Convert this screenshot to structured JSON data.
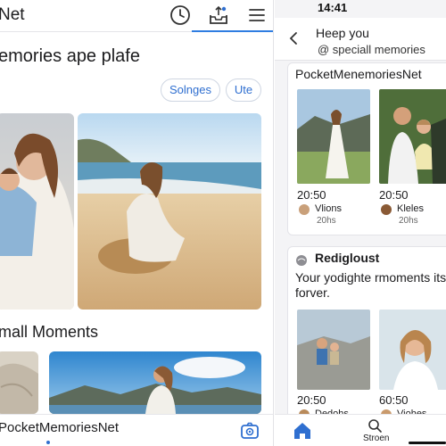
{
  "left": {
    "brand": "Net",
    "header_icons": [
      "clock-icon",
      "inbox-upload-icon",
      "menu-icon"
    ],
    "title": "emories ape plafe",
    "pills": [
      "Solnges",
      "Ute"
    ],
    "section_title": "mall Moments",
    "bottom_brand": "PocketMemoriesNet",
    "bottom_icon": "camera-refresh-icon"
  },
  "right": {
    "status_time": "14:41",
    "header_line1": "Heep you",
    "header_line2": "@  speciall memories",
    "card1": {
      "title": "PocketMenemoriesNet",
      "items": [
        {
          "time": "20:50",
          "name": "Vlions",
          "duration": "20hs"
        },
        {
          "time": "20:50",
          "name": "Kleles",
          "duration": "20hs"
        }
      ]
    },
    "card2": {
      "title": "Redigloust",
      "subtitle_line1": "Your yodighte rmoments its",
      "subtitle_line2": "forver.",
      "items": [
        {
          "time": "20:50",
          "name": "Dedohs"
        },
        {
          "time": "60:50",
          "name": "Viohes"
        }
      ]
    },
    "nav": {
      "search_label": "Stroen"
    }
  },
  "colors": {
    "accent": "#2f6fd0",
    "background": "#ffffff",
    "panel": "#f4f4f6"
  }
}
